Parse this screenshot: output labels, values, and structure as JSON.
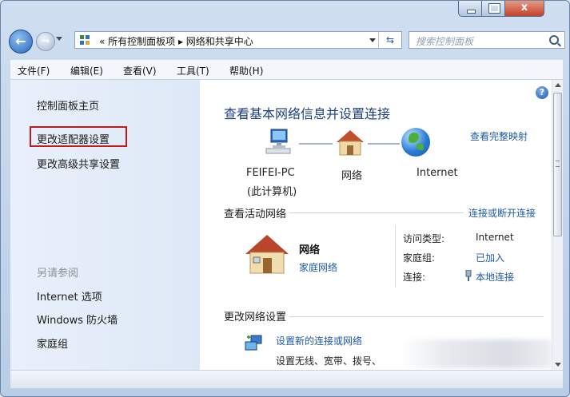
{
  "window": {
    "close_glyph": "x"
  },
  "nav": {
    "back_glyph": "←",
    "forward_glyph": "→",
    "address": {
      "breadcrumb": "«  所有控制面板项  ▸  网络和共享中心"
    },
    "refresh_glyph": "⇆",
    "search": {
      "placeholder": "搜索控制面板"
    }
  },
  "menu": {
    "items": [
      "文件(F)",
      "编辑(E)",
      "查看(V)",
      "工具(T)",
      "帮助(H)"
    ]
  },
  "sidebar": {
    "links": [
      "控制面板主页",
      "更改适配器设置",
      "更改高级共享设置"
    ],
    "see_also_heading": "另请参阅",
    "see_also": [
      "Internet 选项",
      "Windows 防火墙",
      "家庭组"
    ]
  },
  "main": {
    "help_glyph": "?",
    "title": "查看基本网络信息并设置连接",
    "view_full_map": "查看完整映射",
    "nodes": {
      "pc_name": "FEIFEI-PC",
      "pc_note": "(此计算机)",
      "network": "网络",
      "internet": "Internet"
    },
    "active": {
      "heading": "查看活动网络",
      "connect_link": "连接或断开连接",
      "network_name": "网络",
      "network_type": "家庭网络",
      "access_label": "访问类型:",
      "access_value": "Internet",
      "homegroup_label": "家庭组:",
      "homegroup_value": "已加入",
      "connection_label": "连接:",
      "connection_value": "本地连接"
    },
    "change": {
      "heading": "更改网络设置",
      "setup_link": "设置新的连接或网络",
      "setup_desc": "设置无线、宽带、拨号、"
    }
  }
}
